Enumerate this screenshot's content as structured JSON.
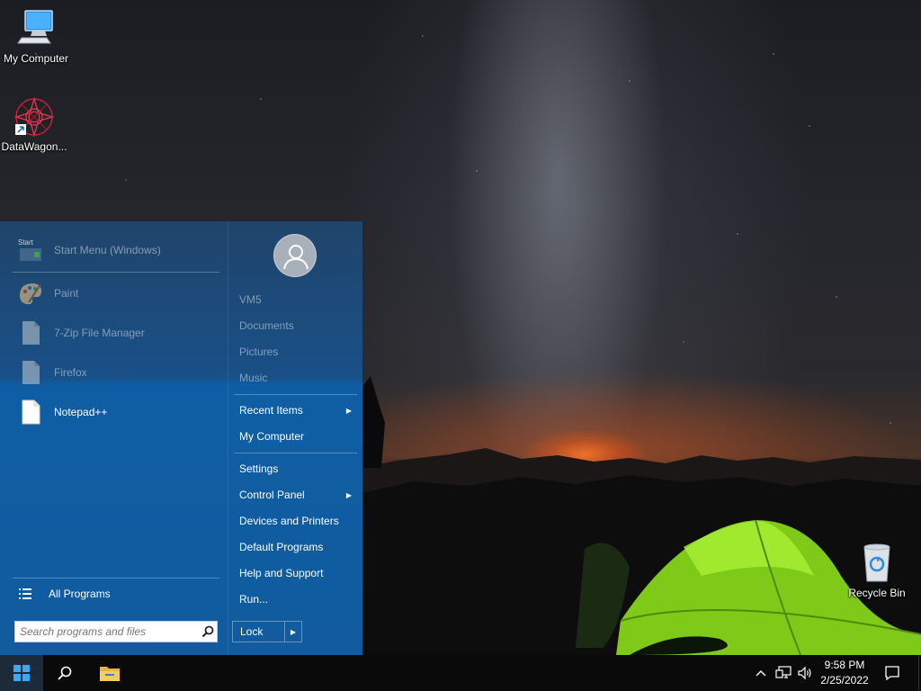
{
  "desktop": {
    "icons": [
      {
        "label": "My Computer",
        "icon": "computer-icon"
      },
      {
        "label": "DataWagon...",
        "icon": "datawagon-icon"
      },
      {
        "label": "Recycle Bin",
        "icon": "recycle-bin-icon"
      }
    ]
  },
  "start_menu": {
    "pinned": [
      {
        "label": "Start Menu (Windows)",
        "icon": "start-menu-app-icon"
      },
      {
        "label": "Paint",
        "icon": "paint-palette-icon"
      },
      {
        "label": "7-Zip File Manager",
        "icon": "file-icon"
      },
      {
        "label": "Firefox",
        "icon": "file-icon"
      },
      {
        "label": "Notepad++",
        "icon": "file-icon"
      }
    ],
    "all_programs": "All Programs",
    "search": {
      "placeholder": "Search programs and files"
    },
    "user": {
      "avatar_icon": "user-avatar-icon"
    },
    "right_items": [
      {
        "label": "VM5"
      },
      {
        "label": "Documents"
      },
      {
        "label": "Pictures"
      },
      {
        "label": "Music"
      },
      {
        "label": "Recent Items",
        "has_submenu": true
      },
      {
        "label": "My Computer"
      },
      {
        "label": "Settings"
      },
      {
        "label": "Control Panel",
        "has_submenu": true
      },
      {
        "label": "Devices and Printers"
      },
      {
        "label": "Default Programs"
      },
      {
        "label": "Help and Support"
      },
      {
        "label": "Run..."
      }
    ],
    "lock": {
      "label": "Lock",
      "arrow_icon": "triangle-right-icon"
    }
  },
  "taskbar": {
    "start_icon": "windows-logo-icon",
    "search_icon": "search-icon",
    "explorer_icon": "file-explorer-folder-icon",
    "tray": {
      "chevron_icon": "chevron-up-icon",
      "network_icon": "network-icon",
      "volume_icon": "speaker-icon",
      "notifications_icon": "notification-icon"
    },
    "clock": {
      "time": "9:58 PM",
      "date": "2/25/2022"
    }
  },
  "colors": {
    "start_menu_blue": "#115b9e",
    "taskbar": "#0a0a0b",
    "tent_green": "#8fd91e"
  }
}
